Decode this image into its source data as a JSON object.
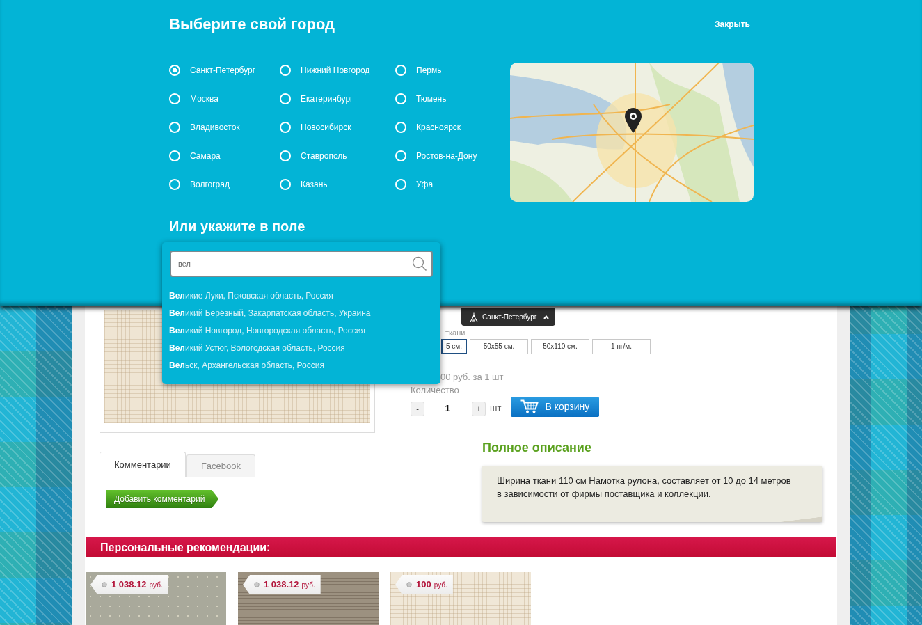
{
  "city_dialog": {
    "title": "Выберите свой город",
    "close": "Закрыть",
    "cities": [
      {
        "name": "Санкт-Петербург",
        "selected": true
      },
      {
        "name": "Нижний Новгород",
        "selected": false
      },
      {
        "name": "Пермь",
        "selected": false
      },
      {
        "name": "Москва",
        "selected": false
      },
      {
        "name": "Екатеринбург",
        "selected": false
      },
      {
        "name": "Тюмень",
        "selected": false
      },
      {
        "name": "Владивосток",
        "selected": false
      },
      {
        "name": "Новосибирск",
        "selected": false
      },
      {
        "name": "Красноярск",
        "selected": false
      },
      {
        "name": "Самара",
        "selected": false
      },
      {
        "name": "Ставрополь",
        "selected": false
      },
      {
        "name": "Ростов-на-Дону",
        "selected": false
      },
      {
        "name": "Волгоград",
        "selected": false
      },
      {
        "name": "Казань",
        "selected": false
      },
      {
        "name": "Уфа",
        "selected": false
      }
    ],
    "search_heading": "Или укажите в поле",
    "search": {
      "value": "вел",
      "suggestions": [
        "**Вел**икие Луки, Псковская область, Россия",
        "**Вел**икий Берёзный, Закарпатская область, Украина",
        "**Вел**икий Новгород, Новгородская область, Россия",
        "**Вел**икий Устюг, Вологодская область, Россия",
        "**Вел**ьск, Архангельская область, Россия"
      ]
    }
  },
  "product": {
    "city_tab": {
      "label": "Санкт-Петербург",
      "expanded": true
    },
    "size_label": "ткани",
    "sizes": [
      {
        "label": "5 см.",
        "selected": true
      },
      {
        "label": "50x55 см.",
        "selected": false
      },
      {
        "label": "50x110 см.",
        "selected": false
      },
      {
        "label": "1 пг/м.",
        "selected": false
      }
    ],
    "price_text": "00 руб. за 1 шт",
    "quantity_label": "Количество",
    "quantity": {
      "minus": "-",
      "value": "1",
      "plus": "+",
      "unit": "шт"
    },
    "cart_button": "В корзину",
    "tabs": [
      {
        "label": "Комментарии",
        "selected": true
      },
      {
        "label": "Facebook",
        "selected": false
      }
    ],
    "add_comment_button": "Добавить комментарий",
    "description": {
      "title": "Полное описание",
      "text": "Ширина ткани 110 см Намотка рулона, составляет от 10 до 14 метров в зависимости от фирмы поставщика и коллекции."
    },
    "recommendations": {
      "title": "Персональные рекомендации:",
      "items": [
        {
          "price": "1 038.12",
          "currency": "руб."
        },
        {
          "price": "1 038.12",
          "currency": "руб."
        },
        {
          "price": "100",
          "currency": "руб."
        }
      ]
    }
  }
}
